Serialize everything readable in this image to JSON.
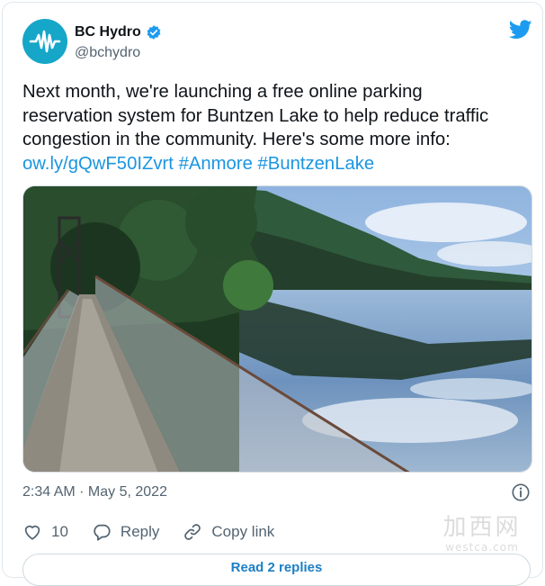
{
  "account": {
    "display_name": "BC Hydro",
    "handle": "@bchydro",
    "verified_icon": "verified-badge-icon",
    "brand_color": "#15a6c8"
  },
  "tweet": {
    "text_line1": "Next month, we're launching a free online parking",
    "text_line2": "reservation system for Buntzen Lake to help reduce traffic",
    "text_line3": "congestion in the community. Here's some more info:",
    "link_url": "ow.ly/gQwF50IZvrt",
    "hashtag1": "#Anmore",
    "hashtag2": "#BuntzenLake",
    "link_color": "#1b95e0"
  },
  "meta": {
    "timestamp": "2:34 AM · May 5, 2022"
  },
  "actions": {
    "like_count": "10",
    "reply_label": "Reply",
    "copy_link_label": "Copy link"
  },
  "footer": {
    "read_replies_label": "Read 2 replies"
  },
  "watermark": {
    "big": "加西网",
    "small": "westca.com"
  }
}
